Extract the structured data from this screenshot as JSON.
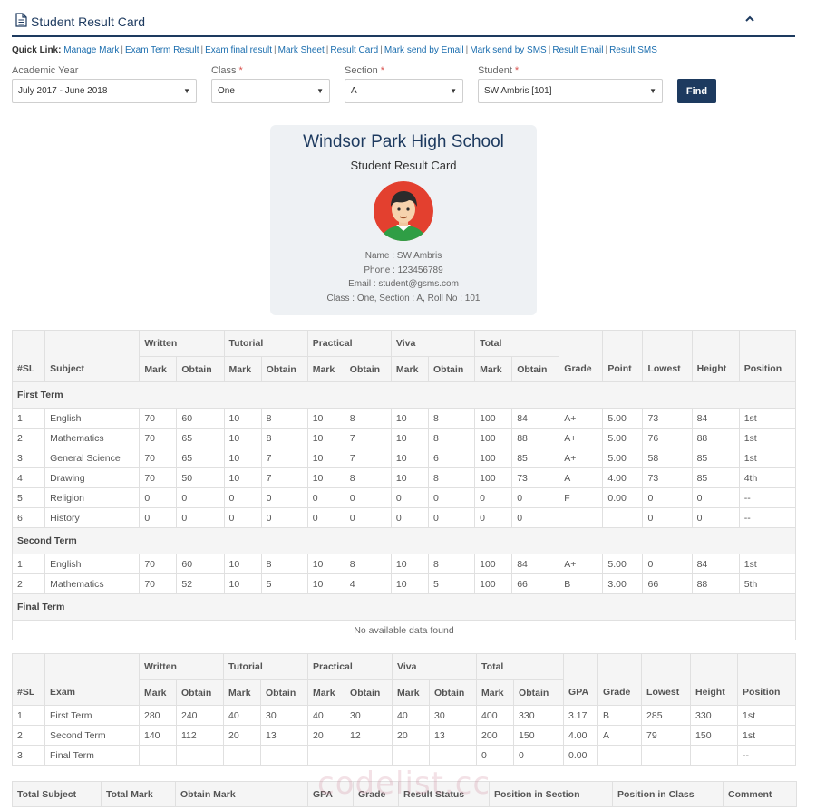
{
  "panel": {
    "title": "Student Result Card",
    "collapse_icon": "chevron-up-icon",
    "title_icon": "document-icon"
  },
  "quick_links": {
    "label": "Quick Link:",
    "items": [
      "Manage Mark",
      "Exam Term Result",
      "Exam final result",
      "Mark Sheet",
      "Result Card",
      "Mark send by Email",
      "Mark send by SMS",
      "Result Email",
      "Result SMS"
    ]
  },
  "filters": {
    "academic_year": {
      "label": "Academic Year",
      "value": "July 2017 - June 2018"
    },
    "class": {
      "label": "Class",
      "required": "*",
      "value": "One"
    },
    "section": {
      "label": "Section",
      "required": "*",
      "value": "A"
    },
    "student": {
      "label": "Student",
      "required": "*",
      "value": "SW Ambris [101]"
    },
    "find_label": "Find"
  },
  "card": {
    "school": "Windsor Park High School",
    "subtitle": "Student Result Card",
    "name": "Name : SW Ambris",
    "phone": "Phone : 123456789",
    "email": "Email : student@gsms.com",
    "class_info": "Class : One, Section : A, Roll No : 101"
  },
  "mark_table": {
    "h1": {
      "sl": "#SL",
      "subject": "Subject",
      "written": "Written",
      "tutorial": "Tutorial",
      "practical": "Practical",
      "viva": "Viva",
      "total": "Total",
      "grade": "Grade",
      "point": "Point",
      "lowest": "Lowest",
      "height": "Height",
      "position": "Position"
    },
    "mark": "Mark",
    "obtain": "Obtain",
    "terms": [
      {
        "name": "First Term",
        "rows": [
          [
            "1",
            "English",
            "70",
            "60",
            "10",
            "8",
            "10",
            "8",
            "10",
            "8",
            "100",
            "84",
            "A+",
            "5.00",
            "73",
            "84",
            "1st"
          ],
          [
            "2",
            "Mathematics",
            "70",
            "65",
            "10",
            "8",
            "10",
            "7",
            "10",
            "8",
            "100",
            "88",
            "A+",
            "5.00",
            "76",
            "88",
            "1st"
          ],
          [
            "3",
            "General Science",
            "70",
            "65",
            "10",
            "7",
            "10",
            "7",
            "10",
            "6",
            "100",
            "85",
            "A+",
            "5.00",
            "58",
            "85",
            "1st"
          ],
          [
            "4",
            "Drawing",
            "70",
            "50",
            "10",
            "7",
            "10",
            "8",
            "10",
            "8",
            "100",
            "73",
            "A",
            "4.00",
            "73",
            "85",
            "4th"
          ],
          [
            "5",
            "Religion",
            "0",
            "0",
            "0",
            "0",
            "0",
            "0",
            "0",
            "0",
            "0",
            "0",
            "F",
            "0.00",
            "0",
            "0",
            "--"
          ],
          [
            "6",
            "History",
            "0",
            "0",
            "0",
            "0",
            "0",
            "0",
            "0",
            "0",
            "0",
            "0",
            "",
            "",
            "0",
            "0",
            "--"
          ]
        ]
      },
      {
        "name": "Second Term",
        "rows": [
          [
            "1",
            "English",
            "70",
            "60",
            "10",
            "8",
            "10",
            "8",
            "10",
            "8",
            "100",
            "84",
            "A+",
            "5.00",
            "0",
            "84",
            "1st"
          ],
          [
            "2",
            "Mathematics",
            "70",
            "52",
            "10",
            "5",
            "10",
            "4",
            "10",
            "5",
            "100",
            "66",
            "B",
            "3.00",
            "66",
            "88",
            "5th"
          ]
        ]
      },
      {
        "name": "Final Term",
        "rows": [],
        "empty": "No available data found"
      }
    ]
  },
  "exam_table": {
    "h1": {
      "sl": "#SL",
      "exam": "Exam",
      "written": "Written",
      "tutorial": "Tutorial",
      "practical": "Practical",
      "viva": "Viva",
      "total": "Total",
      "gpa": "GPA",
      "grade": "Grade",
      "lowest": "Lowest",
      "height": "Height",
      "position": "Position"
    },
    "mark": "Mark",
    "obtain": "Obtain",
    "rows": [
      [
        "1",
        "First Term",
        "280",
        "240",
        "40",
        "30",
        "40",
        "30",
        "40",
        "30",
        "400",
        "330",
        "3.17",
        "B",
        "285",
        "330",
        "1st"
      ],
      [
        "2",
        "Second Term",
        "140",
        "112",
        "20",
        "13",
        "20",
        "12",
        "20",
        "13",
        "200",
        "150",
        "4.00",
        "A",
        "79",
        "150",
        "1st"
      ],
      [
        "3",
        "Final Term",
        "",
        "",
        "",
        "",
        "",
        "",
        "",
        "",
        "0",
        "0",
        "0.00",
        "",
        "",
        "",
        "--"
      ]
    ]
  },
  "summary_table": {
    "headers": [
      "Total Subject",
      "Total Mark",
      "Obtain Mark",
      "",
      "GPA",
      "Grade",
      "Result Status",
      "Position in Section",
      "Position in Class",
      "Comment"
    ]
  },
  "watermark": "codelist.cc",
  "colors": {
    "primary": "#1d3a5f",
    "link": "#1a6dae",
    "required": "#d9534f",
    "card_bg": "#eef1f4",
    "avatar_bg": "#e3402f"
  }
}
